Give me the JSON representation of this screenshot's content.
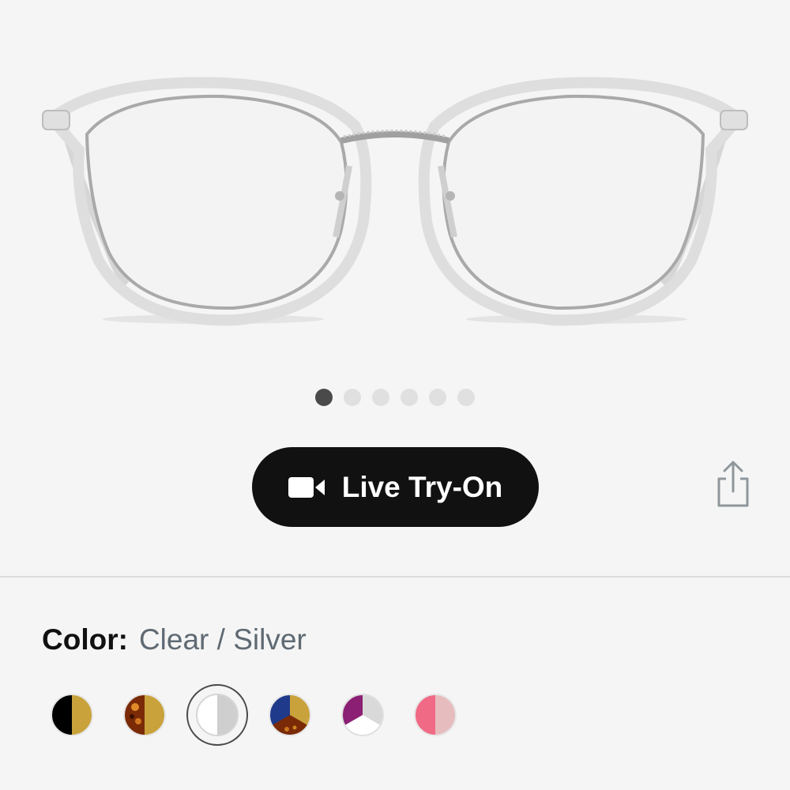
{
  "product": {
    "image_alt": "Clear / Silver round eyeglasses"
  },
  "gallery": {
    "image_count": 6,
    "active_index": 0
  },
  "tryon": {
    "label": "Live Try-On",
    "icon": "video-camera-icon"
  },
  "share": {
    "icon": "share-icon"
  },
  "color": {
    "label": "Color:",
    "value": "Clear / Silver",
    "selected_index": 2,
    "swatches": [
      {
        "name": "Black / Gold",
        "colors": [
          "#000000",
          "#c9a23c"
        ]
      },
      {
        "name": "Tortoise / Gold",
        "colors": [
          "#7a2a06",
          "#c9a23c"
        ]
      },
      {
        "name": "Clear / Silver",
        "colors": [
          "#ffffff",
          "#cfcfcf"
        ]
      },
      {
        "name": "Navy / Gold / Tortoise",
        "colors": [
          "#1f3a8a",
          "#c9a23c",
          "#7a2a06"
        ]
      },
      {
        "name": "Purple / Clear",
        "colors": [
          "#8a1f74",
          "#d9d9d9",
          "#ffffff"
        ]
      },
      {
        "name": "Pink / Blush",
        "colors": [
          "#f06a85",
          "#e6bcbf"
        ]
      }
    ]
  }
}
